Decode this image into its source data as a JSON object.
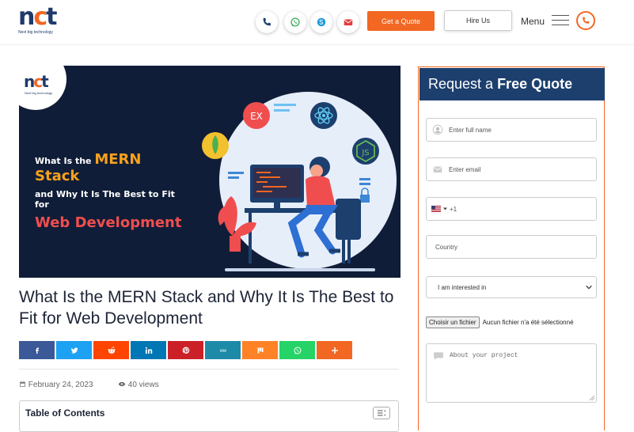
{
  "header": {
    "logo_mark": "nct",
    "logo_tagline": "Next big technology",
    "contact_icons": [
      "phone-icon",
      "whatsapp-icon",
      "skype-icon",
      "mail-icon"
    ],
    "quote_button": "Get a Quote",
    "hire_button": "Hire Us",
    "menu_label": "Menu",
    "accent_color": "#f26722"
  },
  "banner": {
    "line1_prefix": "What Is the ",
    "line1_highlight": "MERN Stack",
    "line2": "and Why It Is The Best to Fit for",
    "line3": "Web Development",
    "tech_badges": [
      "EX",
      "JS"
    ]
  },
  "article": {
    "title": "What Is the MERN Stack and Why It Is The Best to Fit for Web Development",
    "date": "February 24, 2023",
    "views": "40 views",
    "toc_title": "Table of Contents"
  },
  "share_bar": [
    {
      "name": "facebook",
      "color": "#3b5998"
    },
    {
      "name": "twitter",
      "color": "#1da1f2"
    },
    {
      "name": "reddit",
      "color": "#ff4500"
    },
    {
      "name": "linkedin",
      "color": "#0077b5"
    },
    {
      "name": "pinterest",
      "color": "#cb2027"
    },
    {
      "name": "mewe",
      "color": "#1d8aa8"
    },
    {
      "name": "mix",
      "color": "#ff8226"
    },
    {
      "name": "whatsapp",
      "color": "#25d366"
    },
    {
      "name": "more",
      "color": "#f26722"
    }
  ],
  "form": {
    "heading_prefix": "Request a",
    "heading_bold": "Free Quote",
    "name_placeholder": "Enter full name",
    "email_placeholder": "Enter email",
    "phone_prefix": "+1",
    "country_placeholder": "Country",
    "interest_selected": "I am interested in",
    "file_button": "Choisir un fichier",
    "file_status": "Aucun fichier n'a été sélectionné",
    "project_placeholder": "About your project",
    "header_color": "#1c3f6e"
  }
}
